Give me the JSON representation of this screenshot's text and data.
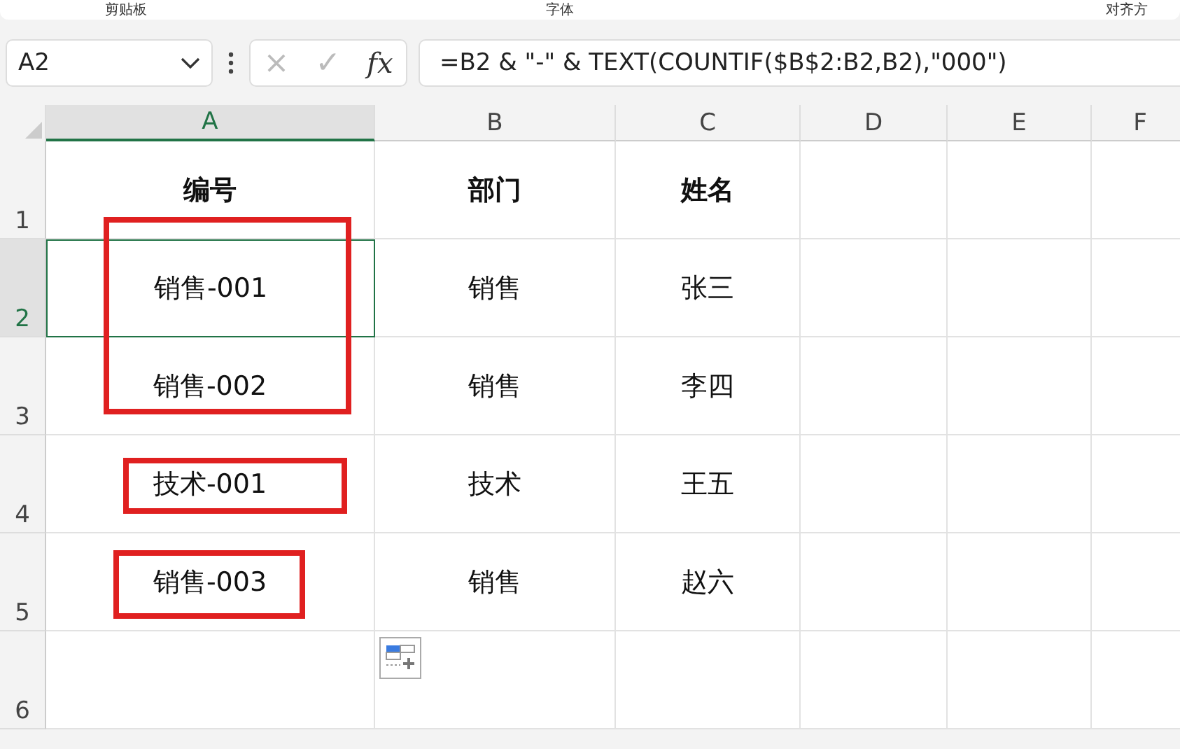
{
  "ribbon": {
    "groups": [
      "剪贴板",
      "字体",
      "对齐方"
    ]
  },
  "formula_bar": {
    "name_box": "A2",
    "cancel": "×",
    "enter": "✓",
    "fx": "fx",
    "formula": "=B2 & \"-\" & TEXT(COUNTIF($B$2:B2,B2),\"000\")"
  },
  "columns": [
    {
      "label": "A",
      "selected": true
    },
    {
      "label": "B",
      "selected": false
    },
    {
      "label": "C",
      "selected": false
    },
    {
      "label": "D",
      "selected": false
    },
    {
      "label": "E",
      "selected": false
    },
    {
      "label": "F",
      "selected": false
    }
  ],
  "rows": [
    {
      "header": "1",
      "selected": false,
      "cells": [
        {
          "text": "编号",
          "header": true,
          "selected": false
        },
        {
          "text": "部门",
          "header": true,
          "selected": false
        },
        {
          "text": "姓名",
          "header": true,
          "selected": false
        }
      ]
    },
    {
      "header": "2",
      "selected": true,
      "cells": [
        {
          "text": "销售-001",
          "header": false,
          "selected": true
        },
        {
          "text": "销售",
          "header": false,
          "selected": false
        },
        {
          "text": "张三",
          "header": false,
          "selected": false
        }
      ]
    },
    {
      "header": "3",
      "selected": false,
      "cells": [
        {
          "text": "销售-002",
          "header": false,
          "selected": false
        },
        {
          "text": "销售",
          "header": false,
          "selected": false
        },
        {
          "text": "李四",
          "header": false,
          "selected": false
        }
      ]
    },
    {
      "header": "4",
      "selected": false,
      "cells": [
        {
          "text": "技术-001",
          "header": false,
          "selected": false
        },
        {
          "text": "技术",
          "header": false,
          "selected": false
        },
        {
          "text": "王五",
          "header": false,
          "selected": false
        }
      ]
    },
    {
      "header": "5",
      "selected": false,
      "cells": [
        {
          "text": "销售-003",
          "header": false,
          "selected": false
        },
        {
          "text": "销售",
          "header": false,
          "selected": false
        },
        {
          "text": "赵六",
          "header": false,
          "selected": false
        }
      ]
    },
    {
      "header": "6",
      "selected": false,
      "cells": []
    }
  ],
  "annotations": [
    {
      "kind": "red-box"
    },
    {
      "kind": "red-box"
    },
    {
      "kind": "red-box"
    }
  ]
}
